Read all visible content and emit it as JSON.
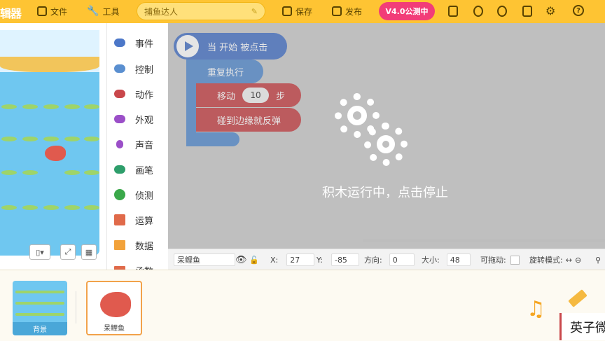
{
  "topbar": {
    "brand": "辑器",
    "file_label": "文件",
    "tools_label": "工具",
    "project_name": "捕鱼达人",
    "save_label": "保存",
    "publish_label": "发布",
    "version_button": "V4.0公测中",
    "accent_color": "#fec433",
    "version_color": "#f23d78"
  },
  "categories": [
    {
      "label": "事件",
      "color": "#4c77c8"
    },
    {
      "label": "控制",
      "color": "#5a8fd0"
    },
    {
      "label": "动作",
      "color": "#c9474b"
    },
    {
      "label": "外观",
      "color": "#9b4fc8"
    },
    {
      "label": "声音",
      "color": "#9b4fc8"
    },
    {
      "label": "画笔",
      "color": "#2e9e6b"
    },
    {
      "label": "侦测",
      "color": "#3aa84a"
    },
    {
      "label": "运算",
      "color": "#e06a4a"
    },
    {
      "label": "数据",
      "color": "#f2a23a"
    },
    {
      "label": "函数",
      "color": "#e06a4a"
    }
  ],
  "script": {
    "hat_block": "当 开始 被点击",
    "repeat_block": "重复执行",
    "move_label": "移动",
    "move_value": "10",
    "move_unit": "步",
    "bounce_block": "碰到边缘就反弹",
    "running_message": "积木运行中，点击停止"
  },
  "sprite_info": {
    "name": "呆鲤鱼",
    "x_label": "X:",
    "x_value": "27",
    "y_label": "Y:",
    "y_value": "-85",
    "direction_label": "方向:",
    "direction_value": "0",
    "size_label": "大小:",
    "size_value": "48",
    "draggable_label": "可拖动:",
    "rotation_label": "旋转模式:"
  },
  "tray": {
    "background_label": "背景",
    "sprite_label": "呆鲤鱼"
  },
  "ime": {
    "text": "英子微"
  }
}
